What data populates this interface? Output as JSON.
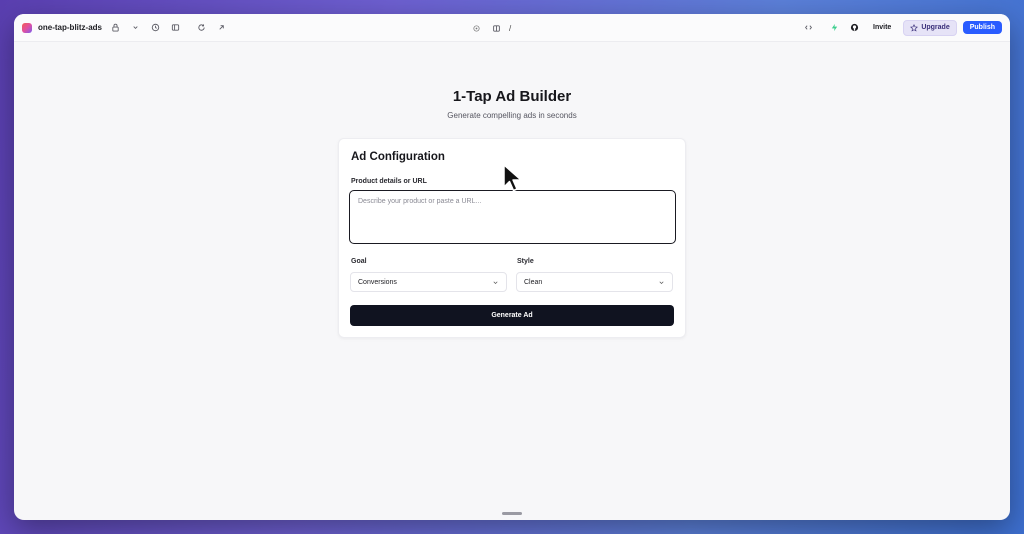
{
  "toolbar": {
    "project_name": "one-tap-blitz-ads",
    "path": "/",
    "invite_label": "Invite",
    "upgrade_label": "Upgrade",
    "publish_label": "Publish"
  },
  "page": {
    "title": "1-Tap Ad Builder",
    "subtitle": "Generate compelling ads in seconds"
  },
  "form": {
    "heading": "Ad Configuration",
    "product_label": "Product details or URL",
    "product_placeholder": "Describe your product or paste a URL...",
    "product_value": "",
    "goal_label": "Goal",
    "goal_value": "Conversions",
    "style_label": "Style",
    "style_value": "Clean",
    "generate_label": "Generate Ad"
  },
  "colors": {
    "publish": "#2a5cff",
    "upgrade_bg": "#e6e3f7",
    "generate_bg": "#101320"
  }
}
